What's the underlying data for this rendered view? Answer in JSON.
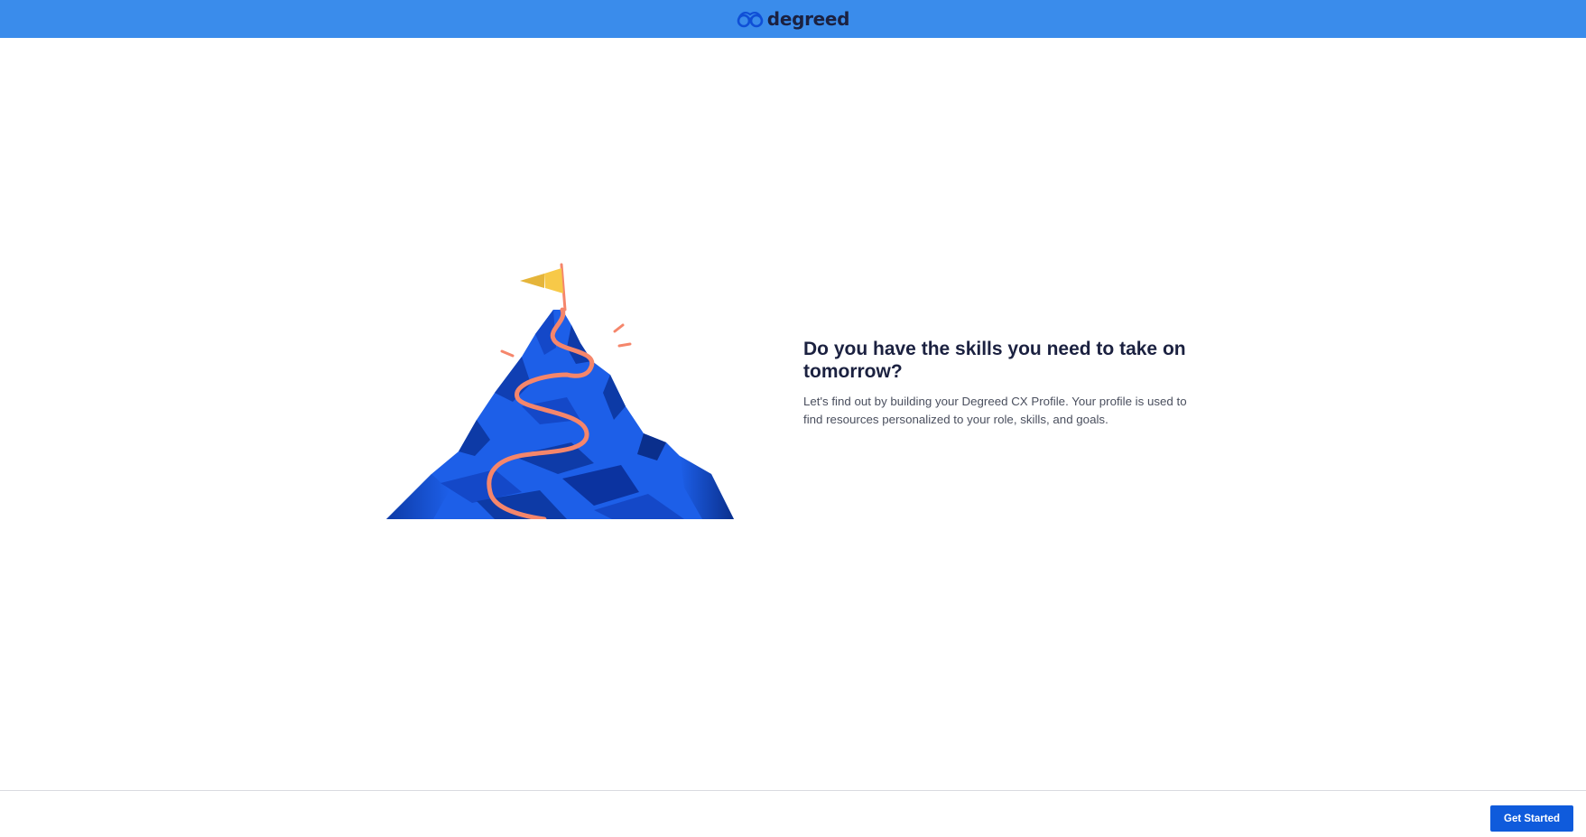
{
  "header": {
    "brand_name": "degreed",
    "logo_icon": "degreed-glasses-logo-icon",
    "background_color": "#3a8ceb"
  },
  "illustration": {
    "icon": "mountain-summit-flag-icon",
    "mountain_color": "#1d5fe8",
    "path_color": "#f5866b",
    "flag_color": "#f7c948"
  },
  "main": {
    "headline": "Do you have the skills you need to take on tomorrow?",
    "description": "Let's find out by building your Degreed CX Profile. Your profile is used to find resources personalized to your role, skills, and goals."
  },
  "footer": {
    "primary_button_label": "Get Started",
    "primary_button_color": "#0f5bdc"
  }
}
